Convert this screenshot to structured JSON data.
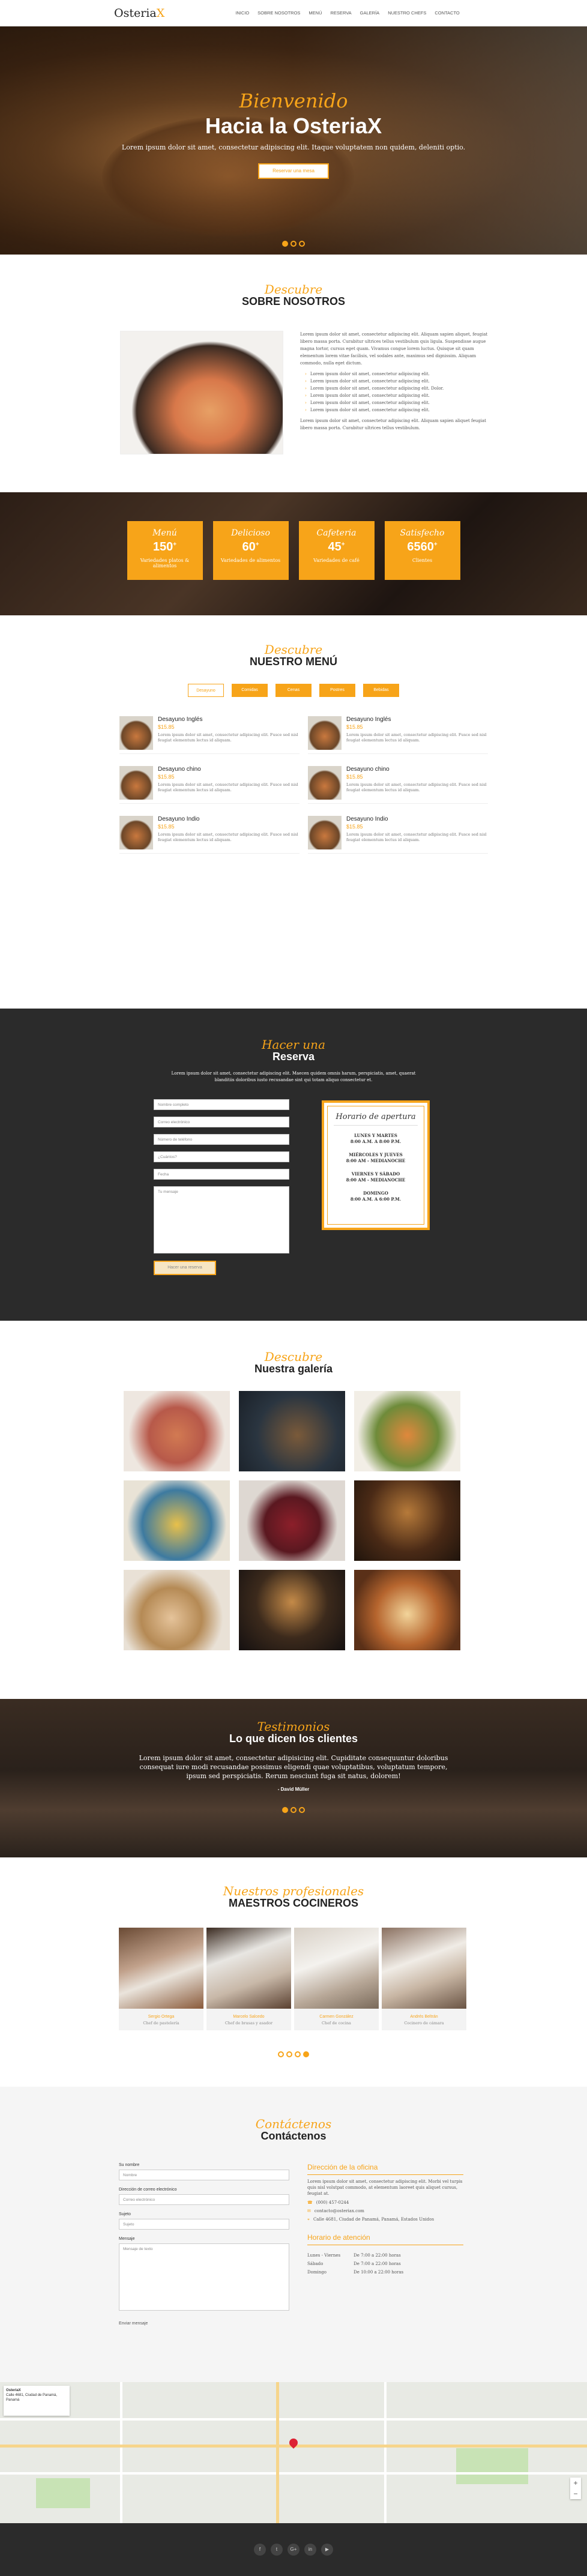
{
  "brand": {
    "name": "Osteria",
    "accent": "X"
  },
  "nav": {
    "items": [
      "Inicio",
      "Sobre nosotros",
      "Menú",
      "Reserva",
      "Galería",
      "Nuestro chefs",
      "Contacto"
    ]
  },
  "hero": {
    "kicker": "Bienvenido",
    "title": "Hacia la OsteriaX",
    "text": "Lorem ipsum dolor sit amet, consectetur adipiscing elit. Itaque voluptatem non quidem, deleniti optio.",
    "button": "Reservar una mesa"
  },
  "about": {
    "kicker": "Descubre",
    "title": "Sobre nosotros",
    "para1": "Lorem ipsum dolor sit amet, consectetur adipiscing elit. Aliquam sapien aliquet, feugiat libero massa porta. Curabitur ultrices tellus vestibulum quis ligula. Suspendisse augue magna tortor, cursus eget quam. Vivamus congue lorem luctus. Quisque sit quam elementum lorem vitae facilisis, vel sodales ante, maximus sed dignissim. Aliquam commodo, nulla eget dictum.",
    "bullets": [
      "Lorem ipsum dolor sit amet, consectetur adipiscing elit.",
      "Lorem ipsum dolor sit amet, consectetur adipiscing elit.",
      "Lorem ipsum dolor sit amet, consectetur adipiscing elit. Dolor.",
      "Lorem ipsum dolor sit amet, consectetur adipiscing elit.",
      "Lorem ipsum dolor sit amet, consectetur adipiscing elit.",
      "Lorem ipsum dolor sit amet, consectetur adipiscing elit."
    ],
    "para2": "Lorem ipsum dolor sit amet, consectetur adipiscing elit. Aliquam sapien aliquet feugiat libero massa porta. Curabitur ultrices tellus vestibulum."
  },
  "stats": [
    {
      "kicker": "Menú",
      "num": "150",
      "label": "Variedades platos & alimentos"
    },
    {
      "kicker": "Delicioso",
      "num": "60",
      "label": "Variedades de alimentos"
    },
    {
      "kicker": "Cafeteria",
      "num": "45",
      "label": "Variedades de café"
    },
    {
      "kicker": "Satisfecho",
      "num": "6560",
      "label": "Clientes"
    }
  ],
  "menu": {
    "kicker": "Descubre",
    "title": "Nuestro menú",
    "tabs": [
      "Desayuno",
      "Comidas",
      "Cenas",
      "Postres",
      "Bebidas"
    ],
    "items": [
      {
        "name": "Desayuno Inglés",
        "price": "$15.85",
        "desc": "Lorem ipsum dolor sit amet, consectetur adipiscing elit. Fusce sed nisl feugiat elementum lectus id aliquam."
      },
      {
        "name": "Desayuno Inglés",
        "price": "$15.85",
        "desc": "Lorem ipsum dolor sit amet, consectetur adipiscing elit. Fusce sed nisl feugiat elementum lectus id aliquam."
      },
      {
        "name": "Desayuno chino",
        "price": "$15.85",
        "desc": "Lorem ipsum dolor sit amet, consectetur adipiscing elit. Fusce sed nisl feugiat elementum lectus id aliquam."
      },
      {
        "name": "Desayuno chino",
        "price": "$15.85",
        "desc": "Lorem ipsum dolor sit amet, consectetur adipiscing elit. Fusce sed nisl feugiat elementum lectus id aliquam."
      },
      {
        "name": "Desayuno Indio",
        "price": "$15.85",
        "desc": "Lorem ipsum dolor sit amet, consectetur adipiscing elit. Fusce sed nisl feugiat elementum lectus id aliquam."
      },
      {
        "name": "Desayuno Indio",
        "price": "$15.85",
        "desc": "Lorem ipsum dolor sit amet, consectetur adipiscing elit. Fusce sed nisl feugiat elementum lectus id aliquam."
      }
    ]
  },
  "reserva": {
    "kicker": "Hacer una",
    "title": "Reserva",
    "intro": "Lorem ipsum dolor sit amet, consectetur adipiscing elit. Maecen quidem omnis harum, perspiciatis, amet, quaerat blanditiis doloribus iusto recusandae sint qui totam aliquo consectetur et.",
    "fields": [
      "Nombre completo",
      "Correo electrónico",
      "Número de teléfono",
      "¿Cuántos?",
      "Fecha",
      "Tu mensaje"
    ],
    "button": "Hacer una reserva",
    "hours_title": "Horario de apertura",
    "hours": [
      {
        "d": "LUNES Y MARTES",
        "h": "8:00 A.M. A 8:00 P.M."
      },
      {
        "d": "MIÉRCOLES Y JUEVES",
        "h": "8:00 AM - MEDIANOCHE"
      },
      {
        "d": "VIERNES Y SÁBADO",
        "h": "8:00 AM - MEDIANOCHE"
      },
      {
        "d": "DOMINGO",
        "h": "8:00 A.M. A 6:00 P.M."
      }
    ]
  },
  "gallery": {
    "kicker": "Descubre",
    "title": "Nuestra galería"
  },
  "testimonial": {
    "kicker": "Testimonios",
    "title": "Lo que dicen los clientes",
    "quote": "Lorem ipsum dolor sit amet, consectetur adipisicing elit. Cupiditate consequuntur doloribus consequat iure modi recusandae possimus eligendi quae voluptatibus, voluptatum tempore, ipsum sed perspiciatis. Rerum nesciunt fuga sit natus, dolorem!",
    "author": "- David Müller"
  },
  "chefs": {
    "kicker": "Nuestros profesionales",
    "title": "Maestros cocineros",
    "list": [
      {
        "name": "Sergio Ortega",
        "role": "Chef de pastelería"
      },
      {
        "name": "Marcelo Salcedo",
        "role": "Chef de brasas y asador"
      },
      {
        "name": "Carmen González",
        "role": "Chef de cocina"
      },
      {
        "name": "Andrés Beltrán",
        "role": "Cocinero de cámara"
      }
    ]
  },
  "contact": {
    "kicker": "Contáctenos",
    "title": "Contáctenos",
    "l_name": "Su nombre",
    "p_name": "Nombre",
    "l_email": "Dirección de correo electrónico",
    "p_email": "Correo electrónico",
    "l_subject": "Sujeto",
    "p_subject": "Sujeto",
    "l_msg": "Mensaje",
    "p_msg": "Mensaje de texto",
    "button": "Enviar mensaje",
    "office_title": "Dirección de la oficina",
    "office_text": "Lorem ipsum dolor sit amet, consectetur adipiscing elit. Morbi vel turpis quis nisl volutpat commodo, at elementum laoreet quis aliquet cursus, feugiat at.",
    "phone": "(000) 457-0244",
    "email": "contacto@osteriax.com",
    "address": "Calle 4681, Ciudad de Panamá, Panamá, Estados Unidos",
    "hours_title": "Horario de atención",
    "hours": [
      {
        "d": "Lunes - Viernes",
        "h": "De 7:00 a 22:00 horas"
      },
      {
        "d": "Sábado",
        "h": "De 7:00 a 22:00 horas"
      },
      {
        "d": "Domingo",
        "h": "De 10:00 a 22:00 horas"
      }
    ]
  },
  "map": {
    "card_title": "OsteriaX",
    "card_text": "Calle 4681, Ciudad de Panamá, Panamá",
    "zoom_in": "+",
    "zoom_out": "−"
  },
  "footer": {
    "social": [
      "f",
      "t",
      "G+",
      "in",
      "▶"
    ]
  }
}
